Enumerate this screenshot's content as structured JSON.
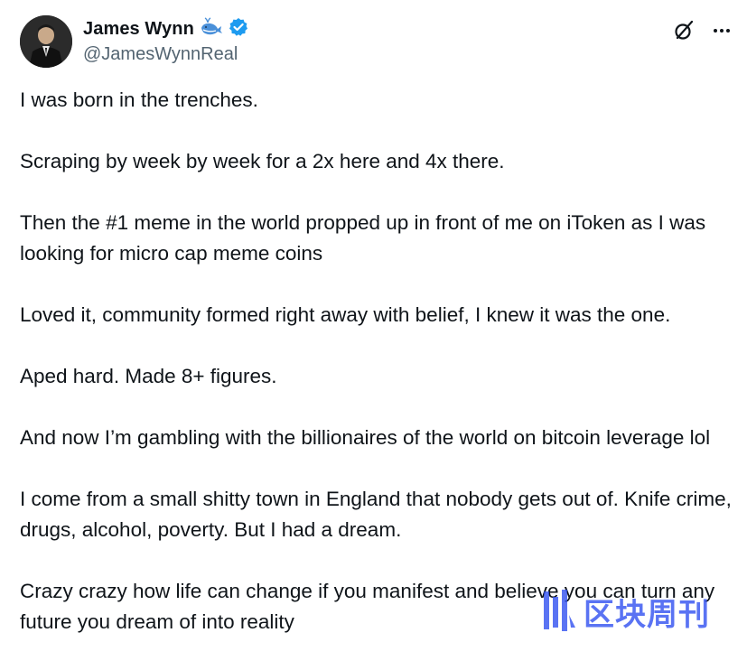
{
  "author": {
    "display_name": "James Wynn",
    "handle": "@JamesWynnReal",
    "badge_emoji": "whale-emoji",
    "verified": true
  },
  "actions": {
    "grok_icon": "grok-icon",
    "more_icon": "more-icon"
  },
  "tweet": {
    "paragraphs": [
      "I was born in the trenches.",
      "Scraping by week by week for a 2x here and 4x there.",
      "Then the #1 meme in the world propped up in front of me on iToken as I was looking for micro cap meme coins",
      "Loved it, community formed right away with belief, I knew it was the one.",
      "Aped hard. Made 8+ figures.",
      "And now I’m gambling with the billionaires of the world on bitcoin leverage lol",
      "I come from a small shitty town in England that nobody gets out of. Knife crime, drugs, alcohol, poverty. But I had a dream.",
      "Crazy crazy how life can change if you manifest and believe you can turn any future you dream of into reality"
    ]
  },
  "watermark": {
    "text": "区块周刊",
    "color": "#2d4df0"
  },
  "colors": {
    "text": "#0f1419",
    "secondary": "#536471",
    "verified_blue": "#1d9bf0",
    "whale_blue": "#4a90d9"
  }
}
